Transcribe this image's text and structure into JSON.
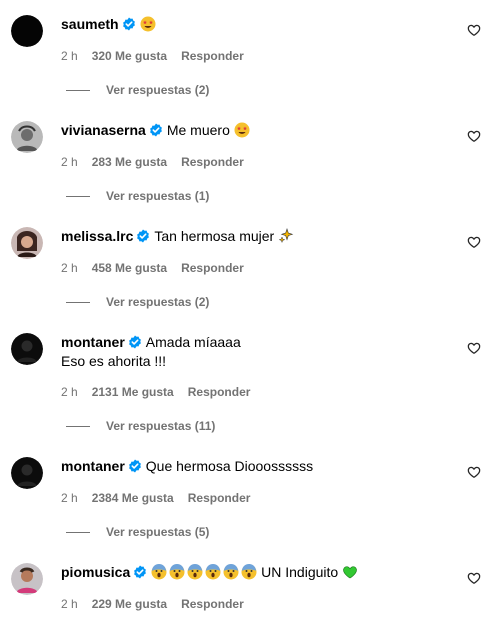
{
  "comments": [
    {
      "username": "saumeth",
      "text": "",
      "text2": "",
      "time": "2 h",
      "likes": "320 Me gusta",
      "reply": "Responder",
      "replies": "Ver respuestas (2)"
    },
    {
      "username": "vivianaserna",
      "text": "Me muero",
      "text2": "",
      "time": "2 h",
      "likes": "283 Me gusta",
      "reply": "Responder",
      "replies": "Ver respuestas (1)"
    },
    {
      "username": "melissa.lrc",
      "text": "Tan hermosa mujer",
      "text2": "",
      "time": "2 h",
      "likes": "458 Me gusta",
      "reply": "Responder",
      "replies": "Ver respuestas (2)"
    },
    {
      "username": "montaner",
      "text": "Amada míaaaa",
      "text2": "Eso es ahorita !!!",
      "time": "2 h",
      "likes": "2131 Me gusta",
      "reply": "Responder",
      "replies": "Ver respuestas (11)"
    },
    {
      "username": "montaner",
      "text": "Que hermosa Diooossssss",
      "text2": "",
      "time": "2 h",
      "likes": "2384 Me gusta",
      "reply": "Responder",
      "replies": "Ver respuestas (5)"
    },
    {
      "username": "piomusica",
      "text": "UN Indiguito",
      "text2": "",
      "time": "2 h",
      "likes": "229 Me gusta",
      "reply": "Responder",
      "replies": ""
    }
  ],
  "icons": {
    "verified": "verified-badge-icon",
    "like": "heart-outline-icon"
  },
  "colors": {
    "verified": "#0095f6",
    "meta": "#737373"
  }
}
